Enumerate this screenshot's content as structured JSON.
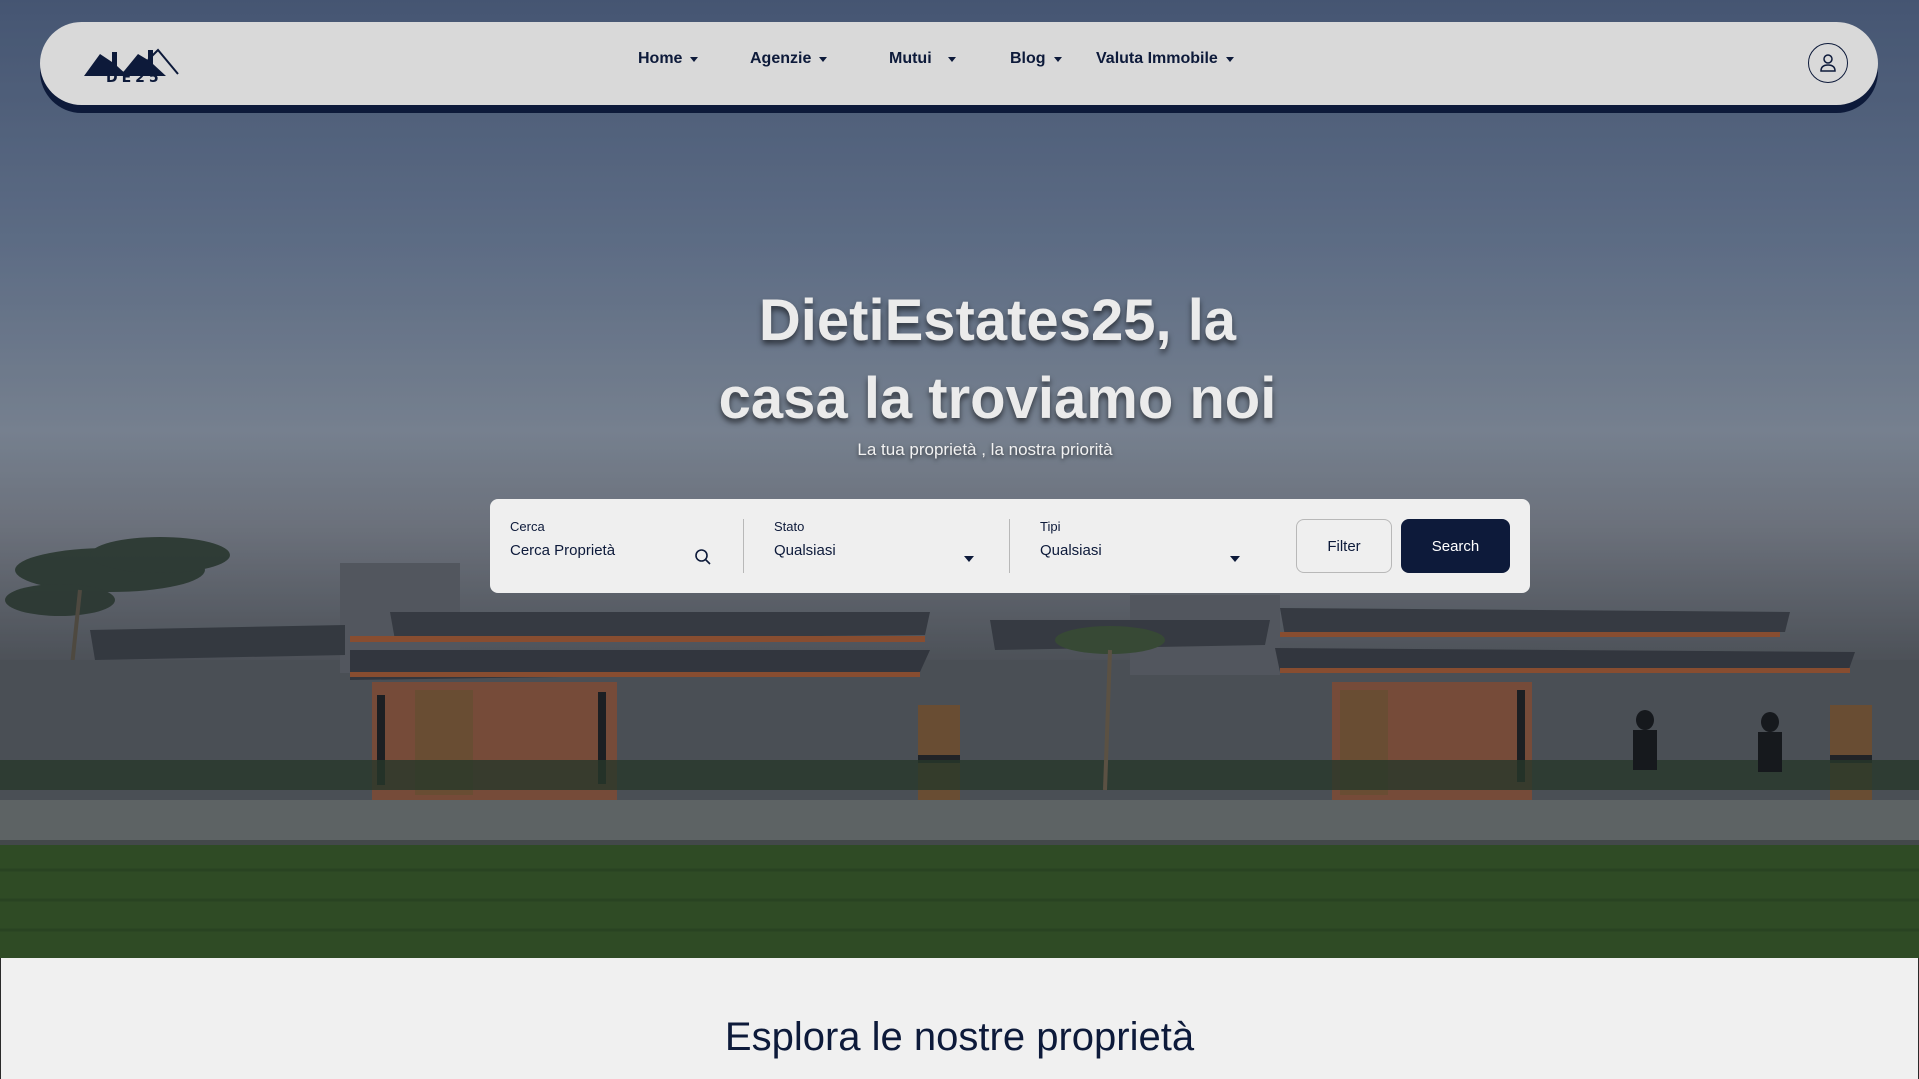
{
  "brand": {
    "logo_text": "DE25"
  },
  "nav": {
    "items": [
      {
        "label": "Home"
      },
      {
        "label": "Agenzie"
      },
      {
        "label": "Mutui"
      },
      {
        "label": "Blog"
      },
      {
        "label": "Valuta Immobile"
      }
    ]
  },
  "hero": {
    "title_line1": "DietiEstates25, la",
    "title_line2": "casa la troviamo noi",
    "subtitle": "La tua proprietà , la nostra priorità"
  },
  "search": {
    "query_label": "Cerca",
    "query_value": "Cerca Proprietà",
    "stato_label": "Stato",
    "stato_value": "Qualsiasi",
    "tipi_label": "Tipi",
    "tipi_value": "Qualsiasi",
    "filter_label": "Filter",
    "search_label": "Search"
  },
  "section": {
    "title": "Esplora le nostre proprietà"
  },
  "colors": {
    "primary": "#0d1a3a",
    "navbar_bg": "#d9d9d9",
    "search_bg": "#efefef"
  }
}
